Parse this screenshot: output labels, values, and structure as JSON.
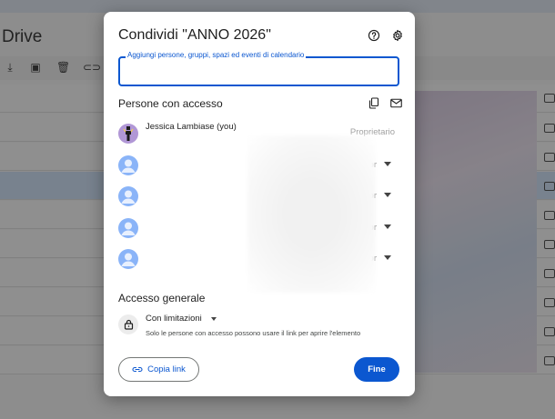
{
  "background": {
    "app_title": "Drive"
  },
  "dialog": {
    "title": "Condividi \"ANNO 2026\"",
    "input_label": "Aggiungi persone, gruppi, spazi ed eventi di calendario",
    "people_heading": "Persone con accesso",
    "people": [
      {
        "name": "Jessica Lambiase (you)",
        "role": "Proprietario"
      },
      {
        "name": "",
        "role": "Editor"
      },
      {
        "name": "",
        "role": "Editor"
      },
      {
        "name": "",
        "role": "Editor"
      },
      {
        "name": "",
        "role": "Editor"
      }
    ],
    "general_access_heading": "Accesso generale",
    "general_access_value": "Con limitazioni",
    "general_access_description": "Solo le persone con accesso possono usare il link per aprire l'elemento",
    "copy_link_label": "Copia link",
    "done_label": "Fine"
  },
  "colors": {
    "accent": "#0b57d0",
    "owner_avatar": "#b197d6",
    "user_avatar": "#8ab4f8"
  },
  "icons": [
    "help-icon",
    "settings-icon",
    "copy-emails-icon",
    "email-icon",
    "lock-icon",
    "link-icon",
    "chevron-down-icon"
  ]
}
